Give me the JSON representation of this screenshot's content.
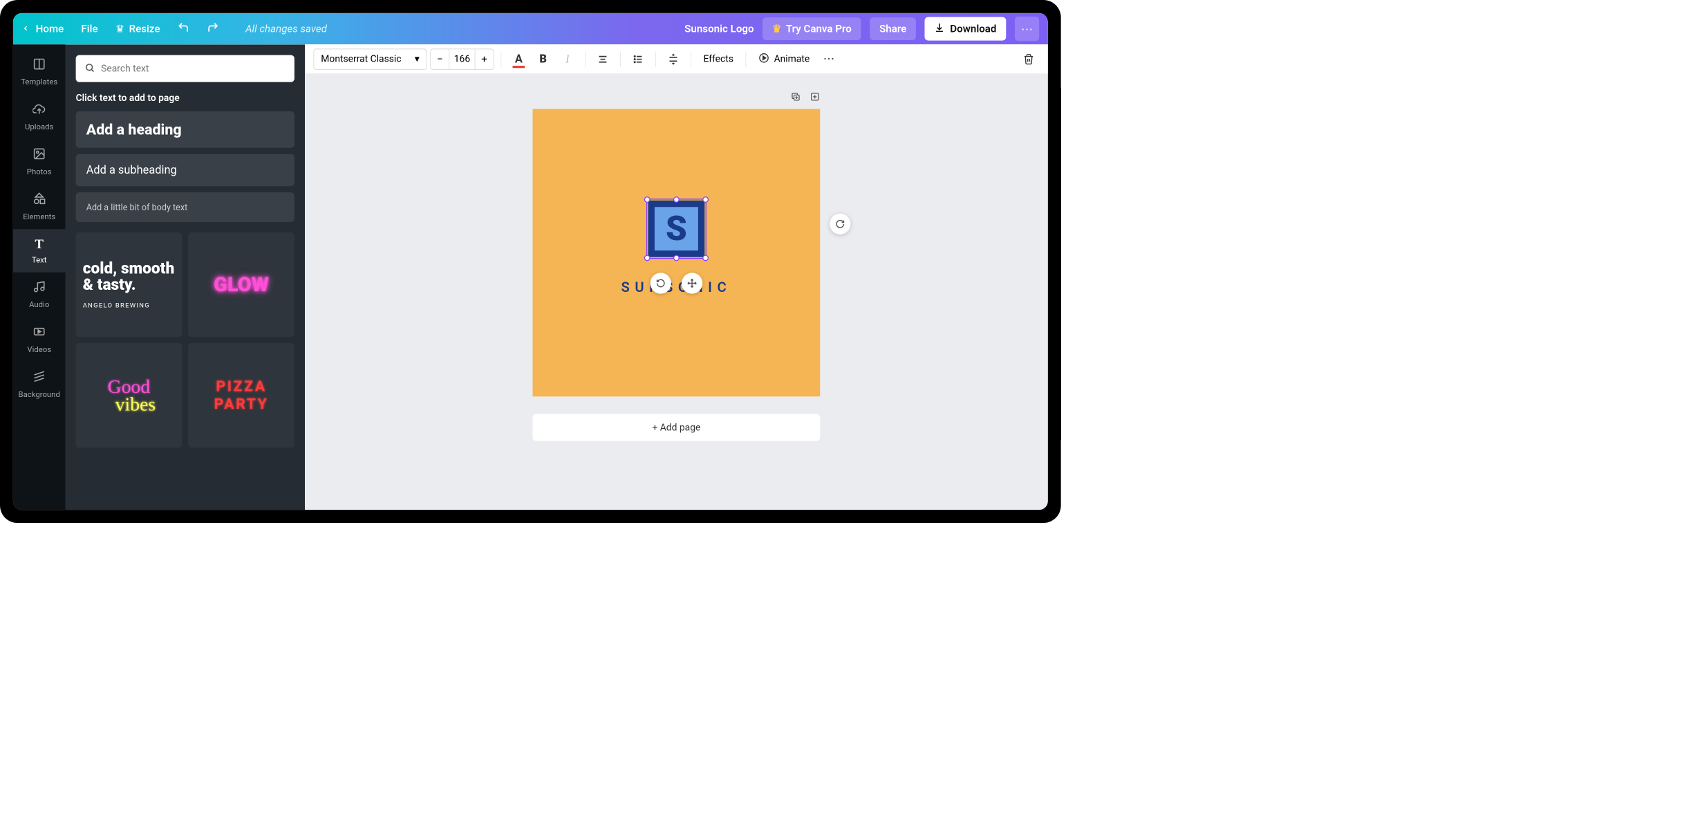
{
  "menubar": {
    "home": "Home",
    "file": "File",
    "resize": "Resize",
    "saved": "All changes saved",
    "doc_title": "Sunsonic Logo",
    "try_pro": "Try Canva Pro",
    "share": "Share",
    "download": "Download"
  },
  "rail": {
    "templates": "Templates",
    "uploads": "Uploads",
    "photos": "Photos",
    "elements": "Elements",
    "text": "Text",
    "audio": "Audio",
    "videos": "Videos",
    "background": "Background"
  },
  "panel": {
    "search_placeholder": "Search text",
    "hint": "Click text to add to page",
    "heading": "Add a heading",
    "subheading": "Add a subheading",
    "body": "Add a little bit of body text",
    "combo1_main": "cold, smooth & tasty.",
    "combo1_sub": "ANGELO BREWING",
    "combo2": "GLOW",
    "combo3_a": "Good",
    "combo3_b": "vibes",
    "combo4": "PIZZA PARTY"
  },
  "toolbar": {
    "font": "Montserrat Classic",
    "size": "166",
    "effects": "Effects",
    "animate": "Animate"
  },
  "canvas": {
    "logo_letter": "S",
    "logo_text": "SUNSONIC",
    "add_page": "+ Add page"
  },
  "colors": {
    "canvas_bg": "#f5b555",
    "logo_blue": "#1a3a8a",
    "text_color_underline": "#e53935"
  }
}
